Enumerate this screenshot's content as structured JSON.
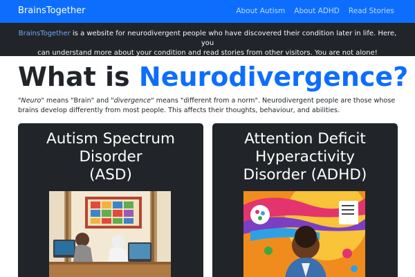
{
  "navbar": {
    "brand": "BrainsTogether",
    "links": [
      "About Autism",
      "About ADHD",
      "Read Stories"
    ]
  },
  "banner": {
    "brand": "BrainsTogether",
    "line1_rest": " is a website for neurodivergent people who have discovered their condition later in life. Here, you",
    "line2": "can understand more about your condition and read stories from other visitors. You are not alone!"
  },
  "main": {
    "title_prefix": "What is ",
    "title_accent": "Neurodivergence?",
    "intro": {
      "neuro": "\"Neuro\"",
      "part1": " means \"Brain\" and ",
      "divergence": "\"divergence\"",
      "part2": " means \"different from a norm\". Neurodivergent people are those whose",
      "line2": "brains develop differently from most people. This affects their thoughts, behaviour, and abilities."
    }
  },
  "cards": [
    {
      "title_lines": [
        "Autism Spectrum",
        "Disorder",
        "(ASD)"
      ]
    },
    {
      "title_lines": [
        "Attention Deficit",
        "Hyperactivity",
        "Disorder (ADHD)"
      ]
    }
  ],
  "colors": {
    "primary": "#0d6efd",
    "dark": "#212529",
    "link_muted": "#6ea8fe"
  }
}
